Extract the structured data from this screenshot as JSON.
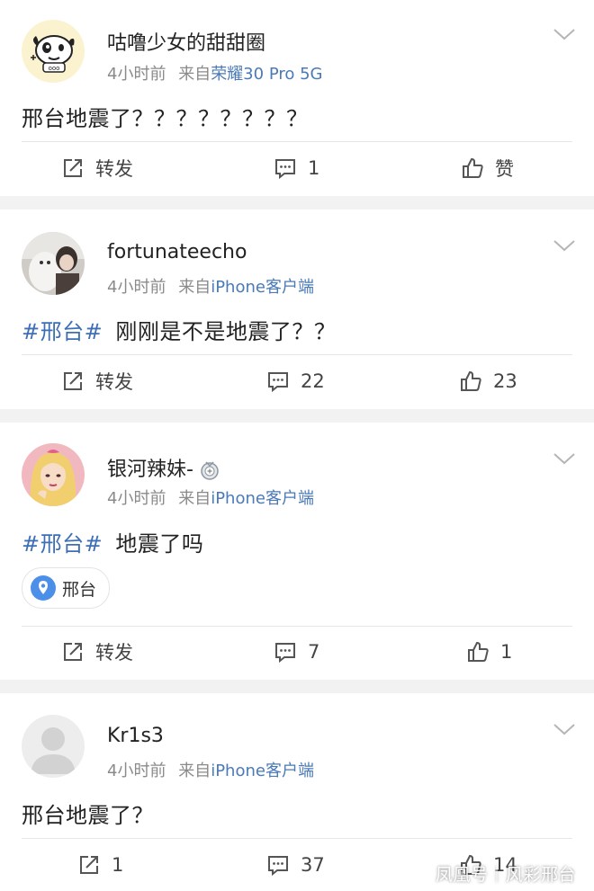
{
  "colors": {
    "link": "#4a7ab8",
    "hashtag": "#3e6fb5",
    "meta": "#8a8a8a",
    "separator": "#f2f2f2"
  },
  "posts": [
    {
      "username": "咕噜少女的甜甜圈",
      "time": "4小时前",
      "from_label": "来自",
      "source": "荣耀30 Pro 5G",
      "hashtag": "",
      "text": "邢台地震了？？？？？？？？",
      "repost": "转发",
      "comments": "1",
      "likes": "赞"
    },
    {
      "username": "fortunateecho",
      "time": "4小时前",
      "from_label": "来自",
      "source": "iPhone客户端",
      "hashtag": "#邢台#",
      "text": "刚刚是不是地震了？？",
      "repost": "转发",
      "comments": "22",
      "likes": "23"
    },
    {
      "username": "银河辣妹-",
      "badge_icon": "medal-icon",
      "time": "4小时前",
      "from_label": "来自",
      "source": "iPhone客户端",
      "hashtag": "#邢台#",
      "text": "地震了吗",
      "location": "邢台",
      "repost": "转发",
      "comments": "7",
      "likes": "1"
    },
    {
      "username": "Kr1s3",
      "time": "4小时前",
      "from_label": "来自",
      "source": "iPhone客户端",
      "hashtag": "",
      "text": "邢台地震了？",
      "repost": "1",
      "comments": "37",
      "likes": "14"
    }
  ],
  "watermark": "凤凰号｜风彩邢台"
}
